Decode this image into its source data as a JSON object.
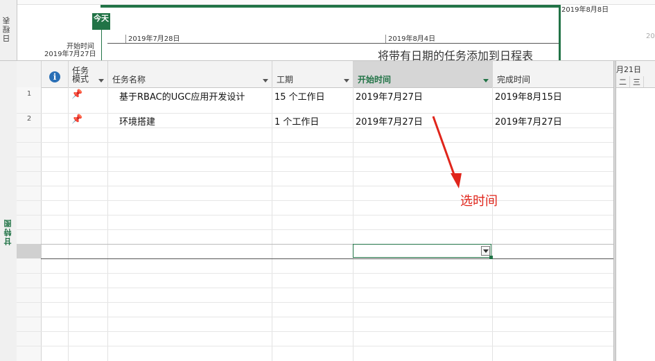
{
  "timeline": {
    "sidebar_label": "日程表",
    "today_label": "今天",
    "start_label": "开始时间",
    "start_date": "2019年7月27日",
    "tick_dates": [
      "2019年7月28日",
      "2019年8月4日"
    ],
    "end_date_label": "2019年8月8日",
    "right_faint_date": "20",
    "hint": "将带有日期的任务添加到日程表"
  },
  "gantt": {
    "sidebar_label": "甘特图",
    "headers": {
      "info_icon": "info-icon",
      "mode_line1": "任务",
      "mode_line2": "模式",
      "name": "任务名称",
      "duration": "工期",
      "start": "开始时间",
      "finish": "完成时间"
    },
    "rows": [
      {
        "num": "1",
        "mode_icon": "pin-icon",
        "name": "基于RBAC的UGC应用开发设计",
        "duration": "15 个工作日",
        "start": "2019年7月27日",
        "finish": "2019年8月15日"
      },
      {
        "num": "2",
        "mode_icon": "pin-icon",
        "name": "环境搭建",
        "duration": "1 个工作日",
        "start": "2019年7月27日",
        "finish": "2019年7月27日"
      }
    ],
    "chart_header": {
      "month": "月21日",
      "days": [
        "二",
        "三"
      ]
    }
  },
  "annotation": {
    "text": "选时间",
    "color": "#e0251b"
  },
  "colors": {
    "accent": "#217346",
    "annotation": "#e0251b",
    "pin": "#3aa3a0"
  }
}
